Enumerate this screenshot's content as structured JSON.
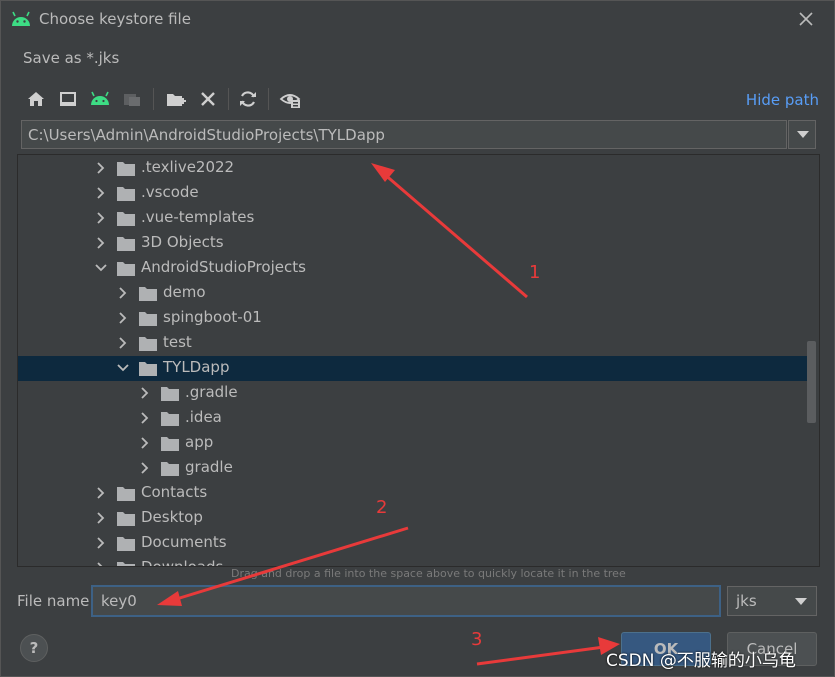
{
  "window": {
    "title": "Choose keystore file",
    "subtitle": "Save as *.jks",
    "accent_icon": "android-icon"
  },
  "toolbar": {
    "buttons": [
      "home-icon",
      "desktop-icon",
      "android-project-icon",
      "module-icon",
      "new-folder-icon",
      "delete-icon",
      "refresh-icon",
      "show-hidden-icon"
    ],
    "hide_path_label": "Hide path"
  },
  "path": {
    "value": "C:\\Users\\Admin\\AndroidStudioProjects\\TYLDapp"
  },
  "tree": {
    "items": [
      {
        "label": ".texlive2022",
        "depth": 0,
        "expanded": false,
        "selected": false
      },
      {
        "label": ".vscode",
        "depth": 0,
        "expanded": false,
        "selected": false
      },
      {
        "label": ".vue-templates",
        "depth": 0,
        "expanded": false,
        "selected": false
      },
      {
        "label": "3D Objects",
        "depth": 0,
        "expanded": false,
        "selected": false
      },
      {
        "label": "AndroidStudioProjects",
        "depth": 0,
        "expanded": true,
        "selected": false
      },
      {
        "label": "demo",
        "depth": 1,
        "expanded": false,
        "selected": false
      },
      {
        "label": "spingboot-01",
        "depth": 1,
        "expanded": false,
        "selected": false
      },
      {
        "label": "test",
        "depth": 1,
        "expanded": false,
        "selected": false
      },
      {
        "label": "TYLDapp",
        "depth": 1,
        "expanded": true,
        "selected": true
      },
      {
        "label": ".gradle",
        "depth": 2,
        "expanded": false,
        "selected": false
      },
      {
        "label": ".idea",
        "depth": 2,
        "expanded": false,
        "selected": false
      },
      {
        "label": "app",
        "depth": 2,
        "expanded": false,
        "selected": false
      },
      {
        "label": "gradle",
        "depth": 2,
        "expanded": false,
        "selected": false
      },
      {
        "label": "Contacts",
        "depth": 0,
        "expanded": false,
        "selected": false
      },
      {
        "label": "Desktop",
        "depth": 0,
        "expanded": false,
        "selected": false
      },
      {
        "label": "Documents",
        "depth": 0,
        "expanded": false,
        "selected": false
      },
      {
        "label": "Downloads",
        "depth": 0,
        "expanded": false,
        "selected": false
      }
    ],
    "hint": "Drag and drop a file into the space above to quickly locate it in the tree"
  },
  "file_name": {
    "label": "File name:",
    "value": "key0"
  },
  "file_type": {
    "value": "jks"
  },
  "buttons": {
    "help": "?",
    "ok": "OK",
    "cancel": "Cancel"
  },
  "annotations": {
    "one": "1",
    "two": "2",
    "three": "3",
    "color": "#e83a3a"
  },
  "watermark": "CSDN @不服输的小乌龟"
}
